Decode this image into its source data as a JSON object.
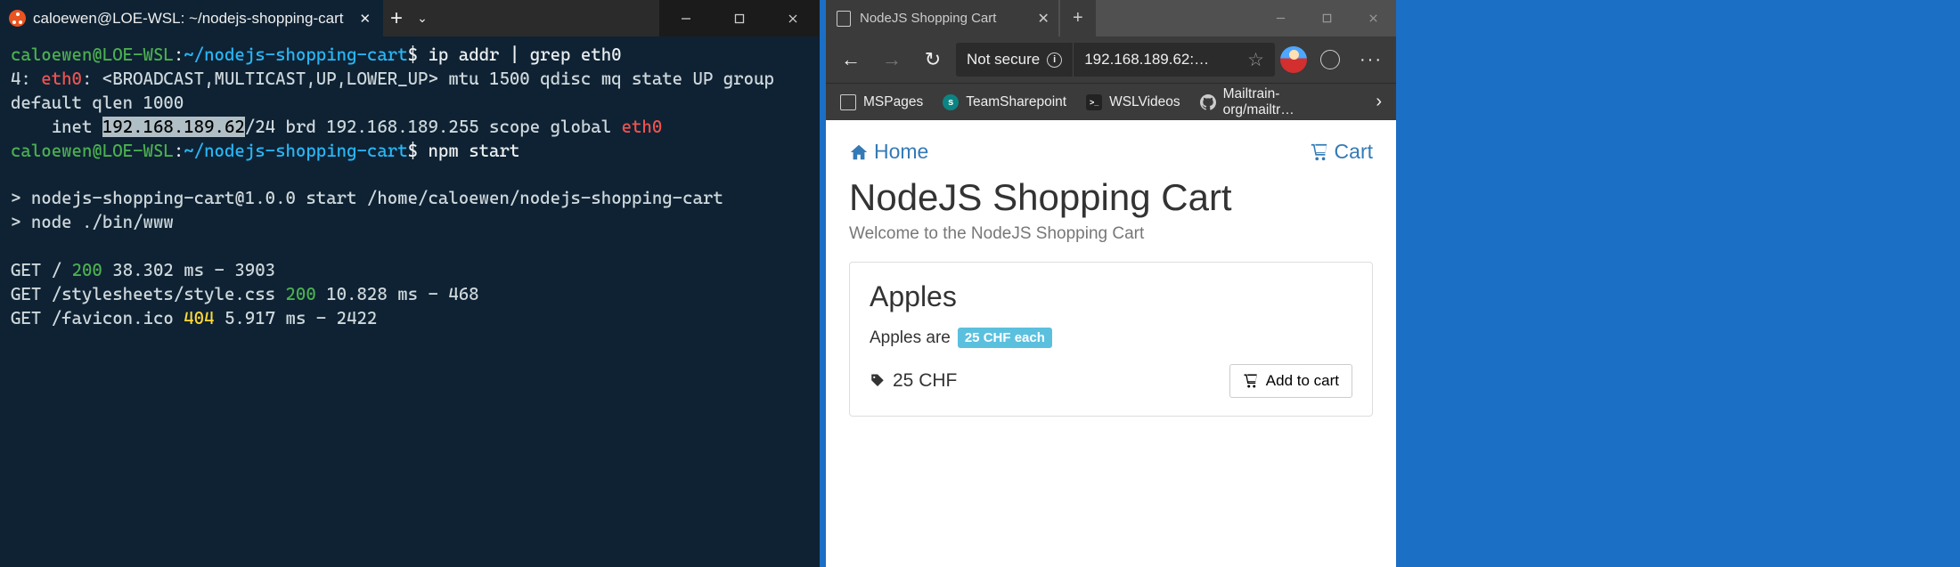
{
  "terminal": {
    "tab_title": "caloewen@LOE-WSL: ~/nodejs-shopping-cart",
    "lines": {
      "p1_user": "caloewen@LOE-WSL",
      "p1_colon": ":",
      "p1_path": "~/nodejs-shopping-cart",
      "p1_dollar": "$ ",
      "p1_cmd": "ip addr | grep eth0",
      "l2a": "4: ",
      "l2b": "eth0",
      "l2c": ": <BROADCAST,MULTICAST,UP,LOWER_UP> mtu 1500 qdisc mq state UP group default qlen 1000",
      "l3a": "    inet ",
      "l3sel": "192.168.189.62",
      "l3b": "/24 brd 192.168.189.255 scope global ",
      "l3c": "eth0",
      "p2_cmd": "npm start",
      "blank": "",
      "l5": "> nodejs-shopping-cart@1.0.0 start /home/caloewen/nodejs-shopping-cart",
      "l6": "> node ./bin/www",
      "g1a": "GET / ",
      "g1b": "200",
      "g1c": " 38.302 ms - 3903",
      "g2a": "GET /stylesheets/style.css ",
      "g2b": "200",
      "g2c": " 10.828 ms - 468",
      "g3a": "GET /favicon.ico ",
      "g3b": "404",
      "g3c": " 5.917 ms - 2422"
    }
  },
  "browser": {
    "tab_title": "NodeJS Shopping Cart",
    "not_secure": "Not secure",
    "url": "192.168.189.62:…",
    "bookmarks": {
      "mspages": "MSPages",
      "sharepoint": "TeamSharepoint",
      "wslvideos": "WSLVideos",
      "mailtrain": "Mailtrain-org/mailtr…"
    },
    "page": {
      "home": "Home",
      "cart": "Cart",
      "title": "NodeJS Shopping Cart",
      "subtitle": "Welcome to the NodeJS Shopping Cart",
      "product": "Apples",
      "desc_pre": "Apples are",
      "badge": "25 CHF each",
      "price": "25 CHF",
      "add_btn": "Add to cart"
    }
  }
}
